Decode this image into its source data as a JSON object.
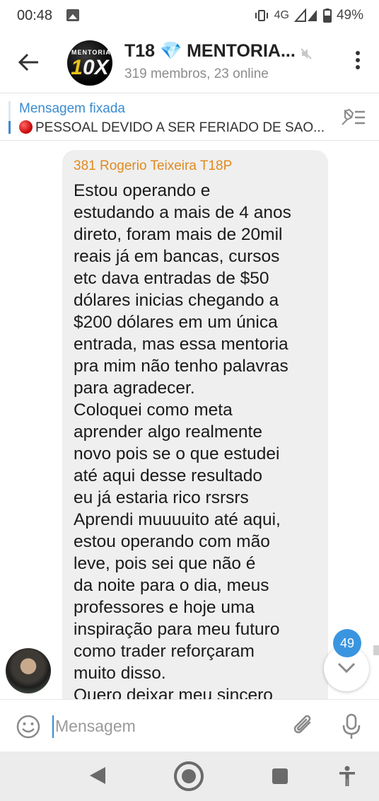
{
  "status_bar": {
    "time": "00:48",
    "network": "4G",
    "battery": "49%"
  },
  "header": {
    "title": "T18 💎 MENTORIA...",
    "subtitle": "319 membros, 23 online",
    "logo_top": "MENTORIA",
    "logo_main_a": "1",
    "logo_main_b": "0X"
  },
  "pinned": {
    "title": "Mensagem fixada",
    "text": "PESSOAL DEVIDO A SER FERIADO DE SAO..."
  },
  "message": {
    "sender": "381 Rogerio Teixeira T18P",
    "text": "Estou operando e\nestudando a mais de 4 anos\ndireto, foram mais de 20mil\nreais já em bancas, cursos\netc dava entradas de $50\ndólares inicias chegando a\n$200 dólares em um única\nentrada, mas essa mentoria\npra mim não tenho palavras\npara agradecer.\nColoquei como meta\naprender algo realmente\nnovo pois se o que estudei\naté aqui desse resultado\neu já estaria rico rsrsrs\nAprendi muuuuito até aqui,\nestou operando com mão\nleve, pois sei que não é\nda noite para o dia, meus\nprofessores e hoje uma\ninspiração para meu futuro\ncomo trader reforçaram\nmuito disso.\nQuero deixar meu sincero"
  },
  "unread_count": "49",
  "composer": {
    "placeholder": "Mensagem"
  },
  "colors": {
    "accent": "#3a8bd0",
    "sender": "#e08a1e",
    "bubble": "#efefef",
    "badge": "#3a95e0"
  }
}
